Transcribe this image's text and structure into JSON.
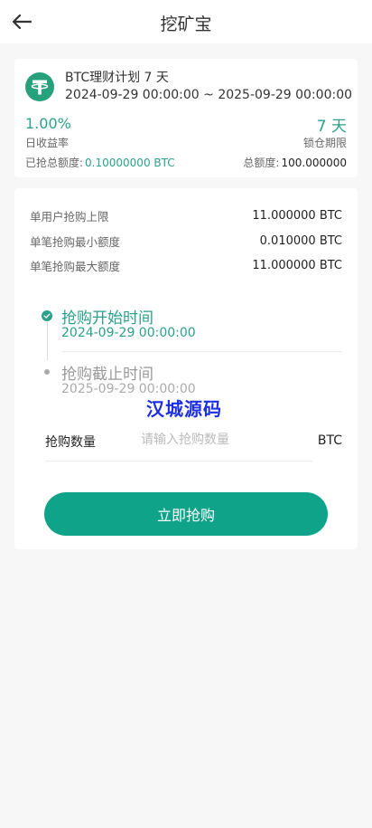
{
  "header": {
    "title": "挖矿宝"
  },
  "plan": {
    "title": "BTC理财计划 7 天",
    "period": "2024-09-29 00:00:00 ~ 2025-09-29 00:00:00",
    "daily_rate_value": "1.00%",
    "daily_rate_label": "日收益率",
    "lock_period_value": "7 天",
    "lock_period_label": "锁仓期限",
    "sold_label": "已抢总额度:",
    "sold_value": "0.10000000 BTC",
    "total_label": "总额度:",
    "total_value": "100.000000"
  },
  "limits": [
    {
      "label": "单用户抢购上限",
      "value": "11.000000 BTC"
    },
    {
      "label": "单笔抢购最小额度",
      "value": "0.010000 BTC"
    },
    {
      "label": "单笔抢购最大额度",
      "value": "11.000000 BTC"
    }
  ],
  "timeline": {
    "start_title": "抢购开始时间",
    "start_time": "2024-09-29 00:00:00",
    "end_title": "抢购截止时间",
    "end_time": "2025-09-29 00:00:00"
  },
  "watermark": "汉城源码",
  "purchase": {
    "quantity_label": "抢购数量",
    "quantity_placeholder": "请输入抢购数量",
    "quantity_value": "",
    "unit": "BTC",
    "button_label": "立即抢购"
  },
  "colors": {
    "accent": "#2aa18a",
    "button": "#0fa48a",
    "coin": "#26a17b"
  }
}
